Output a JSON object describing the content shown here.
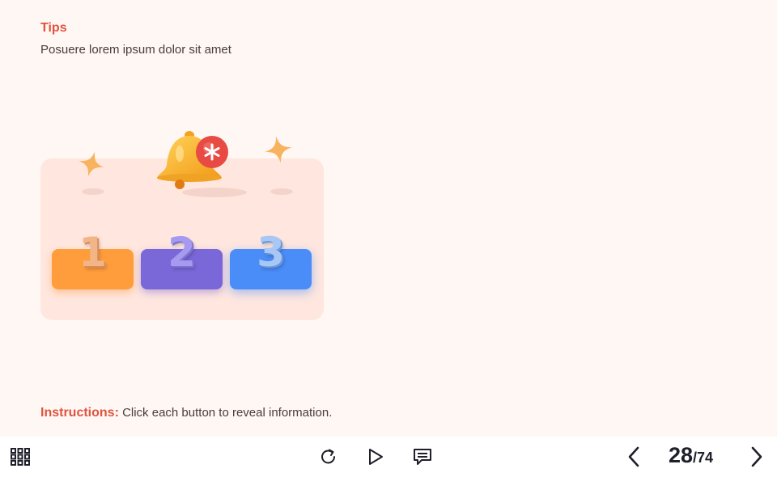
{
  "slide": {
    "title": "Tips",
    "subtitle": "Posuere lorem ipsum dolor sit amet",
    "buttons": [
      {
        "label": "1",
        "color": "#ff9d3c"
      },
      {
        "label": "2",
        "color": "#7a67d8"
      },
      {
        "label": "3",
        "color": "#4a8cf8"
      }
    ],
    "instructions": {
      "label": "Instructions:",
      "text": "Click each button to reveal information."
    }
  },
  "toolbar": {
    "menu_icon": "grid-menu-icon",
    "replay_icon": "replay-icon",
    "play_icon": "play-icon",
    "transcript_icon": "chat-icon",
    "prev_icon": "chevron-left-icon",
    "next_icon": "chevron-right-icon",
    "page_current": "28",
    "page_total": "/74"
  },
  "colors": {
    "accent": "#e0533f",
    "background": "#fff7f4",
    "card": "#ffe7df"
  }
}
